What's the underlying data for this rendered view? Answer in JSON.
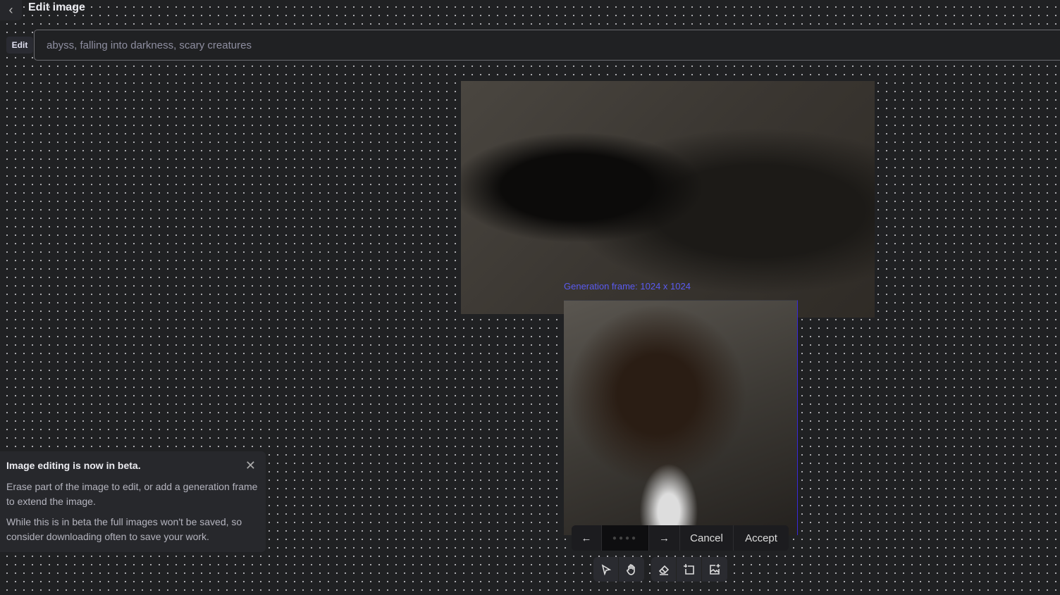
{
  "header": {
    "title": "Edit image"
  },
  "prompt": {
    "mode_label": "Edit",
    "value": "abyss, falling into darkness, scary creatures"
  },
  "canvas": {
    "frame_label": "Generation frame: 1024 x 1024"
  },
  "beta_notice": {
    "title": "Image editing is now in beta.",
    "p1": "Erase part of the image to edit, or add a generation frame to extend the image.",
    "p2": "While this is in beta the full images won't be saved, so consider downloading often to save your work."
  },
  "actions": {
    "cancel": "Cancel",
    "accept": "Accept",
    "prev": "←",
    "next": "→"
  }
}
